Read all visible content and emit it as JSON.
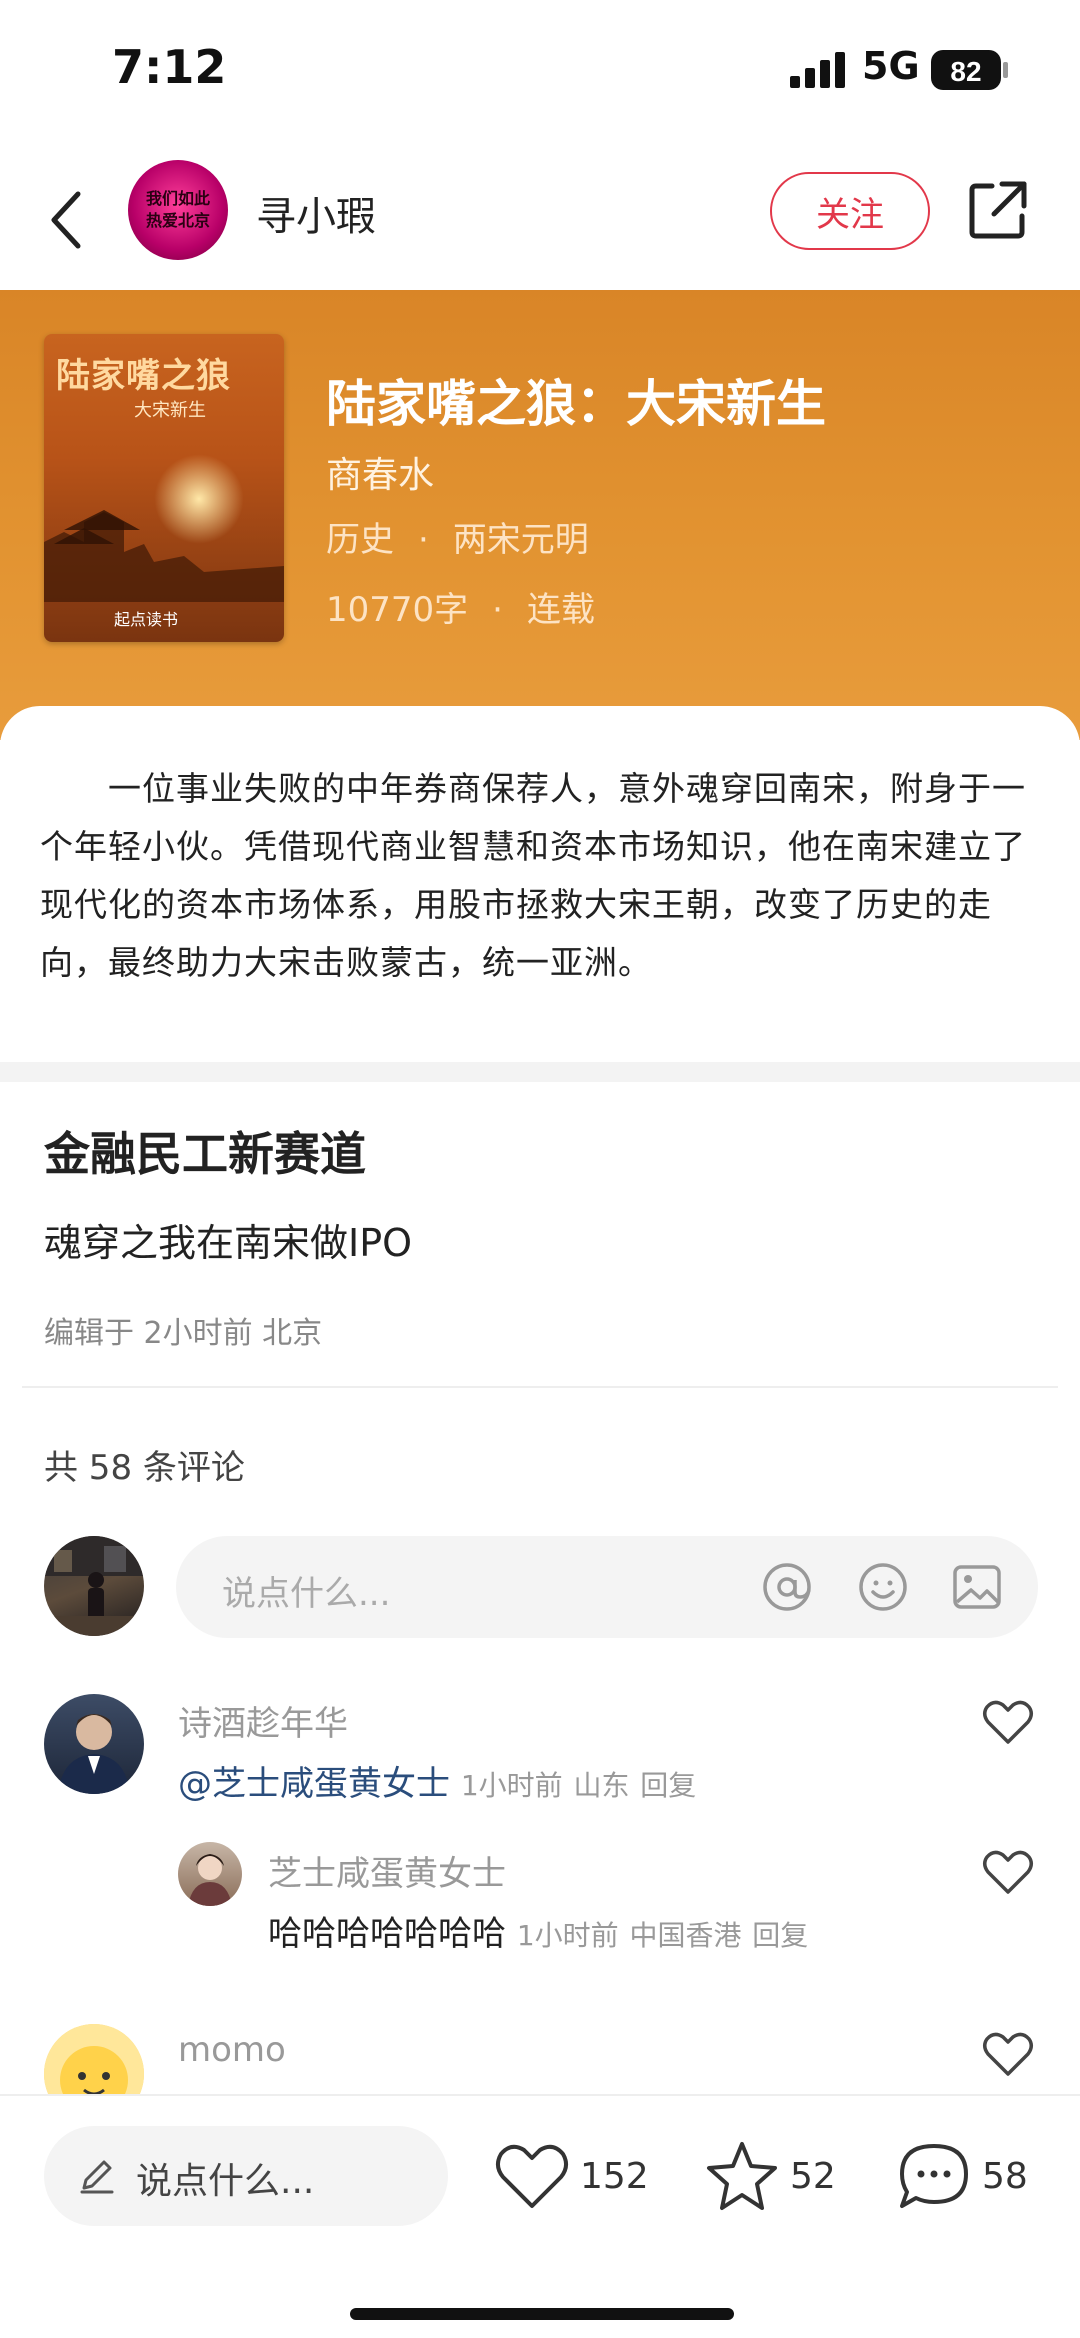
{
  "status_bar": {
    "time": "7:12",
    "network": "5G",
    "battery": "82"
  },
  "header": {
    "author_name": "寻小瑕",
    "avatar_text_line1": "我们如此",
    "avatar_text_line2": "热爱北京",
    "follow_label": "关注"
  },
  "book": {
    "cover_title": "陆家嘴之狼",
    "cover_subtitle": "大宋新生",
    "cover_publisher": "起点读书",
    "title": "陆家嘴之狼：大宋新生",
    "author": "商春水",
    "category": "历史",
    "subcategory": "两宋元明",
    "word_count": "10770字",
    "status": "连载",
    "separator": "·"
  },
  "description": "一位事业失败的中年券商保荐人，意外魂穿回南宋，附身于一个年轻小伙。凭借现代商业智慧和资本市场知识，他在南宋建立了现代化的资本市场体系，用股市拯救大宋王朝，改变了历史的走向，最终助力大宋击败蒙古，统一亚洲。",
  "post": {
    "title": "金融民工新赛道",
    "subtitle": "魂穿之我在南宋做IPO",
    "meta": "编辑于 2小时前 北京"
  },
  "comments_section": {
    "count_label": "共 58 条评论",
    "input_placeholder": "说点什么..."
  },
  "comments": [
    {
      "user": "诗酒趁年华",
      "mention": "@芝士咸蛋黄女士",
      "time": "1小时前",
      "location": "山东",
      "reply": "回复"
    },
    {
      "user": "芝士咸蛋黄女士",
      "text": "哈哈哈哈哈哈哈",
      "time": "1小时前",
      "location": "中国香港",
      "reply": "回复"
    },
    {
      "user": "momo"
    }
  ],
  "bottom_bar": {
    "input_placeholder": "说点什么...",
    "likes": "152",
    "favorites": "52",
    "comments": "58"
  },
  "colors": {
    "accent": "#e2384a",
    "banner": "#e08f2e",
    "mention": "#2a4d7c"
  },
  "icons": [
    "back-icon",
    "share-icon",
    "at-icon",
    "emoji-icon",
    "image-icon",
    "heart-icon",
    "star-icon",
    "chat-icon",
    "pen-icon"
  ]
}
